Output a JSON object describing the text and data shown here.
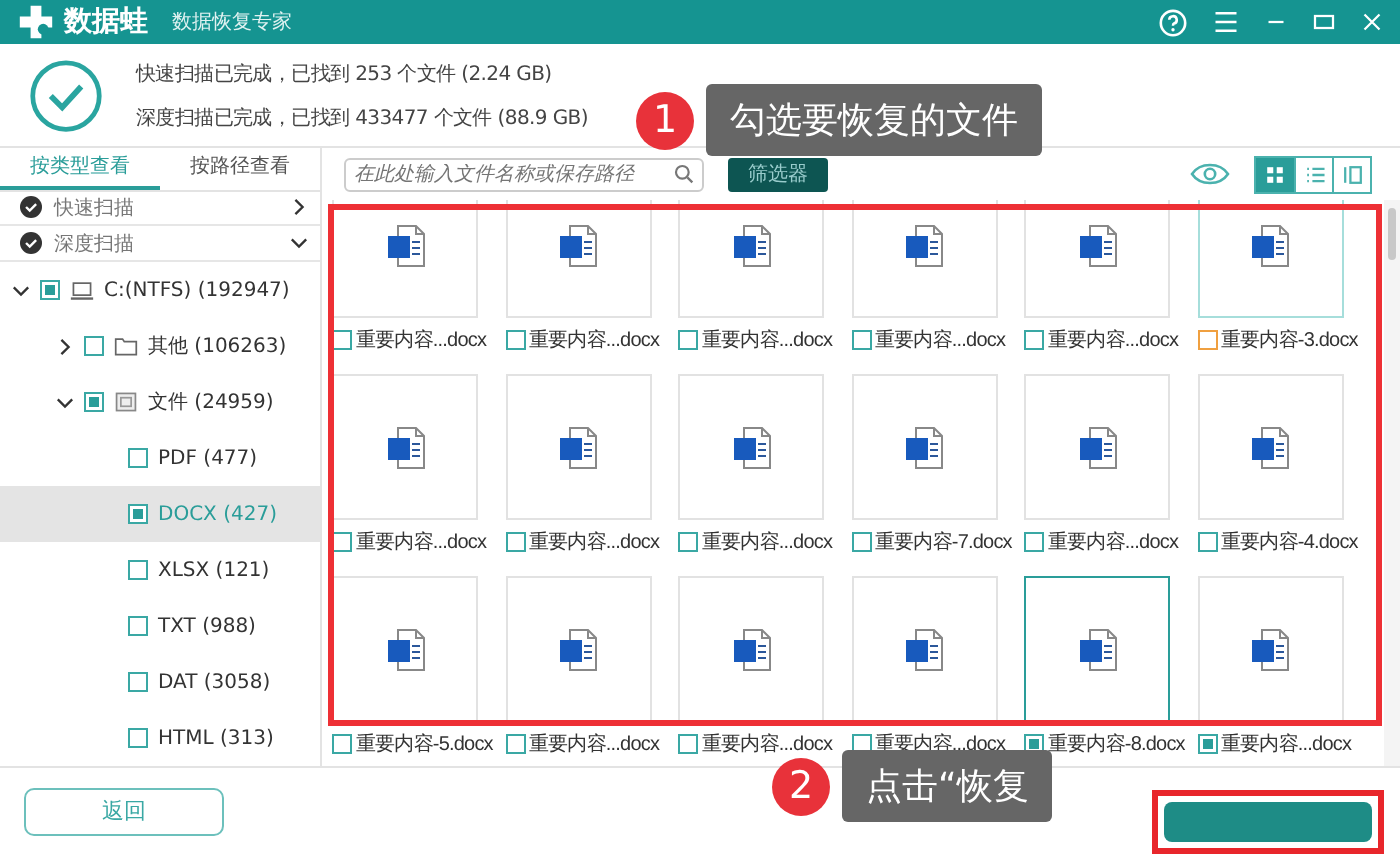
{
  "app": {
    "name": "数据蛙",
    "subtitle": "数据恢复专家"
  },
  "summary": [
    "快速扫描已完成，已找到 253 个文件 (2.24 GB)",
    "深度扫描已完成，已找到 433477 个文件 (88.9 GB)"
  ],
  "view_tabs": [
    {
      "label": "按类型查看",
      "selected": true
    },
    {
      "label": "按路径查看",
      "selected": false
    }
  ],
  "scans": [
    {
      "label": "快速扫描",
      "expanded": false
    },
    {
      "label": "深度扫描",
      "expanded": true
    }
  ],
  "tree": [
    {
      "label": "C:(NTFS) (192947)",
      "kind": "drive",
      "checked": true,
      "expanded": true,
      "selected": false,
      "children": [
        {
          "label": "其他 (106263)",
          "kind": "folder",
          "checked": false,
          "expanded": false,
          "selected": false
        },
        {
          "label": "文件 (24959)",
          "kind": "category",
          "checked": true,
          "expanded": true,
          "selected": false,
          "children": [
            {
              "label": "PDF (477)",
              "checked": false,
              "selected": false
            },
            {
              "label": "DOCX (427)",
              "checked": true,
              "selected": true
            },
            {
              "label": "XLSX (121)",
              "checked": false,
              "selected": false
            },
            {
              "label": "TXT (988)",
              "checked": false,
              "selected": false
            },
            {
              "label": "DAT (3058)",
              "checked": false,
              "selected": false
            },
            {
              "label": "HTML (313)",
              "checked": false,
              "selected": false
            }
          ]
        }
      ]
    }
  ],
  "search": {
    "placeholder": "在此处输入文件名称或保存路径"
  },
  "filter_button": "筛选器",
  "views": [
    {
      "kind": "grid",
      "selected": true
    },
    {
      "kind": "list",
      "selected": false
    },
    {
      "kind": "detail",
      "selected": false
    }
  ],
  "files": [
    {
      "name": "重要内容...docx",
      "checked": false,
      "hovered": false,
      "selected": false
    },
    {
      "name": "重要内容...docx",
      "checked": false,
      "hovered": false,
      "selected": false
    },
    {
      "name": "重要内容...docx",
      "checked": false,
      "hovered": false,
      "selected": false
    },
    {
      "name": "重要内容...docx",
      "checked": false,
      "hovered": false,
      "selected": false
    },
    {
      "name": "重要内容...docx",
      "checked": false,
      "hovered": false,
      "selected": false
    },
    {
      "name": "重要内容-3.docx",
      "checked": false,
      "hovered": true,
      "selected": false
    },
    {
      "name": "重要内容...docx",
      "checked": false,
      "hovered": false,
      "selected": false
    },
    {
      "name": "重要内容...docx",
      "checked": false,
      "hovered": false,
      "selected": false
    },
    {
      "name": "重要内容...docx",
      "checked": false,
      "hovered": false,
      "selected": false
    },
    {
      "name": "重要内容-7.docx",
      "checked": false,
      "hovered": false,
      "selected": false
    },
    {
      "name": "重要内容...docx",
      "checked": false,
      "hovered": false,
      "selected": false
    },
    {
      "name": "重要内容-4.docx",
      "checked": false,
      "hovered": false,
      "selected": false
    },
    {
      "name": "重要内容-5.docx",
      "checked": false,
      "hovered": false,
      "selected": false
    },
    {
      "name": "重要内容...docx",
      "checked": false,
      "hovered": false,
      "selected": false
    },
    {
      "name": "重要内容...docx",
      "checked": false,
      "hovered": false,
      "selected": false
    },
    {
      "name": "重要内容...docx",
      "checked": false,
      "hovered": false,
      "selected": false
    },
    {
      "name": "重要内容-8.docx",
      "checked": true,
      "hovered": false,
      "selected": true
    },
    {
      "name": "重要内容...docx",
      "checked": true,
      "hovered": false,
      "selected": false
    }
  ],
  "back_button": "返回",
  "callouts": [
    {
      "number": "1",
      "text": "勾选要恢复的文件"
    },
    {
      "number": "2",
      "text": "点击“恢复"
    }
  ]
}
